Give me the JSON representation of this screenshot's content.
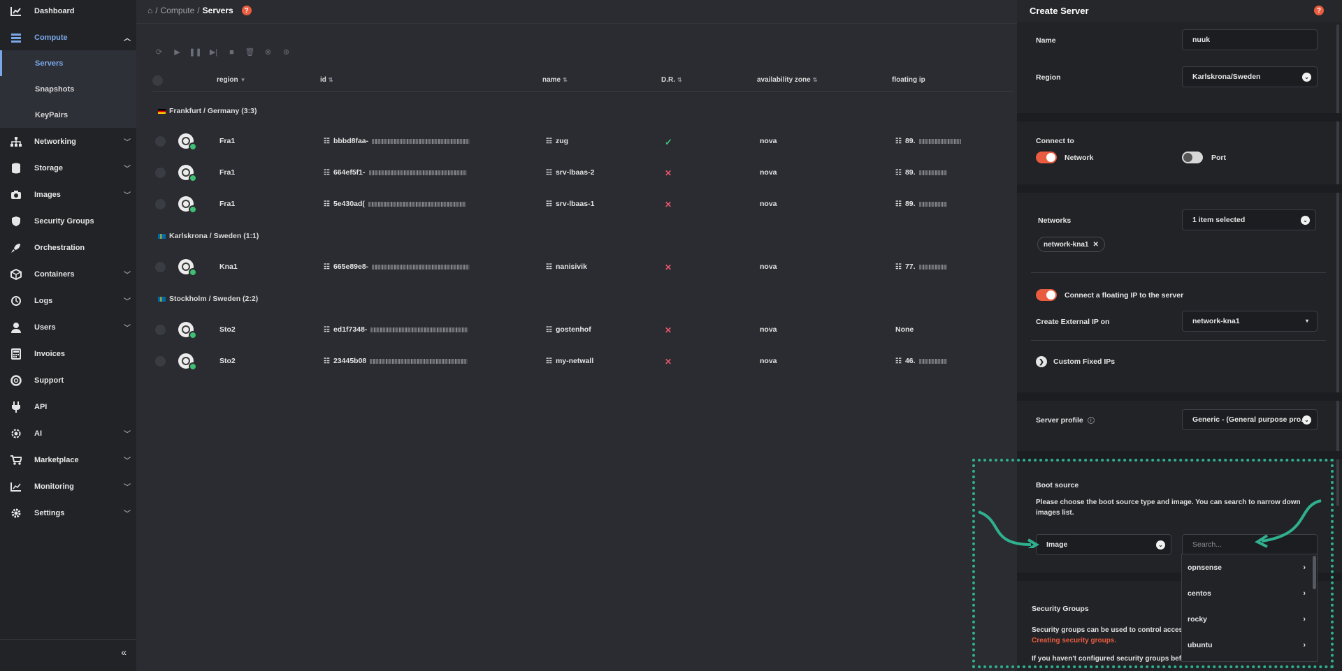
{
  "sidebar": {
    "items": [
      {
        "label": "Dashboard",
        "icon": "chart-icon",
        "expandable": false
      },
      {
        "label": "Compute",
        "icon": "server-stack-icon",
        "expandable": true,
        "expanded": true
      },
      {
        "label": "Networking",
        "icon": "network-icon",
        "expandable": true
      },
      {
        "label": "Storage",
        "icon": "database-icon",
        "expandable": true
      },
      {
        "label": "Images",
        "icon": "camera-icon",
        "expandable": true
      },
      {
        "label": "Security Groups",
        "icon": "shield-icon",
        "expandable": false
      },
      {
        "label": "Orchestration",
        "icon": "rocket-icon",
        "expandable": false
      },
      {
        "label": "Containers",
        "icon": "box-icon",
        "expandable": true
      },
      {
        "label": "Logs",
        "icon": "history-icon",
        "expandable": true
      },
      {
        "label": "Users",
        "icon": "user-icon",
        "expandable": true
      },
      {
        "label": "Invoices",
        "icon": "calculator-icon",
        "expandable": false
      },
      {
        "label": "Support",
        "icon": "lifebuoy-icon",
        "expandable": false
      },
      {
        "label": "API",
        "icon": "plug-icon",
        "expandable": false
      },
      {
        "label": "AI",
        "icon": "gear-brain-icon",
        "expandable": true
      },
      {
        "label": "Marketplace",
        "icon": "cart-icon",
        "expandable": true
      },
      {
        "label": "Monitoring",
        "icon": "line-chart-icon",
        "expandable": true
      },
      {
        "label": "Settings",
        "icon": "gear-icon",
        "expandable": true
      }
    ],
    "compute_sub": [
      "Servers",
      "Snapshots",
      "KeyPairs"
    ],
    "collapse_glyph": "«"
  },
  "breadcrumb": {
    "sep": "/",
    "parent": "Compute",
    "current": "Servers",
    "help": "?"
  },
  "table": {
    "columns": {
      "region": "region",
      "id": "id",
      "name": "name",
      "dr": "D.R.",
      "az": "availability zone",
      "fip": "floating ip"
    },
    "groups": [
      {
        "label": "Frankfurt / Germany (3:3)",
        "flag": "de"
      },
      {
        "label": "Karlskrona / Sweden (1:1)",
        "flag": "se"
      },
      {
        "label": "Stockholm / Sweden (2:2)",
        "flag": "se"
      }
    ],
    "rows": [
      {
        "region": "Fra1",
        "id": "bbbd8faa-",
        "name": "zug",
        "dr": "check",
        "az": "nova",
        "fip": "89."
      },
      {
        "region": "Fra1",
        "id": "664ef5f1-",
        "name": "srv-lbaas-2",
        "dr": "x",
        "az": "nova",
        "fip": "89."
      },
      {
        "region": "Fra1",
        "id": "5e430ad(",
        "name": "srv-lbaas-1",
        "dr": "x",
        "az": "nova",
        "fip": "89."
      },
      {
        "region": "Kna1",
        "id": "665e89e8-",
        "name": "nanisivik",
        "dr": "x",
        "az": "nova",
        "fip": "77."
      },
      {
        "region": "Sto2",
        "id": "ed1f7348-",
        "name": "gostenhof",
        "dr": "x",
        "az": "nova",
        "fip": "None"
      },
      {
        "region": "Sto2",
        "id": "23445b08",
        "name": "my-netwall",
        "dr": "x",
        "az": "nova",
        "fip": "46."
      }
    ]
  },
  "panel": {
    "title": "Create Server",
    "help": "?",
    "name_label": "Name",
    "name_value": "nuuk",
    "region_label": "Region",
    "region_value": "Karlskrona/Sweden",
    "connect_label": "Connect to",
    "network_toggle_label": "Network",
    "port_toggle_label": "Port",
    "networks_label": "Networks",
    "networks_value": "1 item selected",
    "network_chip": "network-kna1",
    "floating_ip_label": "Connect a floating IP to the server",
    "external_ip_label": "Create External IP on",
    "external_ip_value": "network-kna1",
    "custom_fixed_label": "Custom Fixed IPs",
    "profile_label": "Server profile",
    "profile_value": "Generic - (General purpose pro...",
    "boot_label": "Boot source",
    "boot_desc": "Please choose the boot source type and image. You can search to narrow down images list.",
    "boot_type": "Image",
    "search_placeholder": "Search...",
    "image_options": [
      "opnsense",
      "centos",
      "rocky",
      "ubuntu"
    ],
    "sg_label": "Security Groups",
    "sg_desc": "Security groups can be used to control access",
    "sg_link": "Creating security groups.",
    "sg_desc2": "If you haven't configured security groups befor"
  },
  "colors": {
    "accent": "#ea5c3f",
    "active": "#7aa7e8",
    "success": "#3fbf73",
    "danger": "#e5566a",
    "highlight": "#2fb08f"
  }
}
